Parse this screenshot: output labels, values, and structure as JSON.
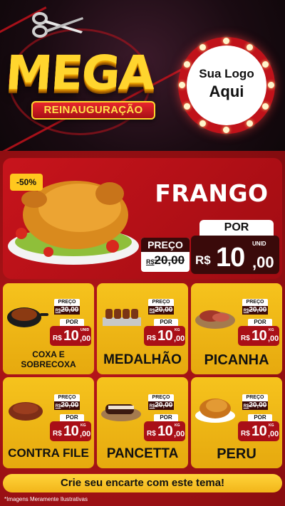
{
  "header": {
    "title": "MEGA",
    "subtitle": "REINAUGURAÇÃO",
    "logo_line1": "Sua Logo",
    "logo_line2": "Aqui"
  },
  "featured": {
    "discount": "-50%",
    "name": "FRANGO",
    "preco_label": "PREÇO",
    "old_currency": "R$",
    "old_price": "20,00",
    "por_label": "POR",
    "currency": "R$",
    "price_int": "10",
    "price_dec": ",00",
    "unit": "UNID"
  },
  "products": [
    {
      "name_line1": "COXA E",
      "name_line2": "SOBRECOXA",
      "preco_label": "PREÇO",
      "old_currency": "R$",
      "old_price": "20,00",
      "por_label": "POR",
      "currency": "R$",
      "price_int": "10",
      "price_dec": ",00",
      "unit": "UNID"
    },
    {
      "name": "MEDALHÃO",
      "preco_label": "PREÇO",
      "old_currency": "R$",
      "old_price": "20,00",
      "por_label": "POR",
      "currency": "R$",
      "price_int": "10",
      "price_dec": ",00",
      "unit": "KG"
    },
    {
      "name": "PICANHA",
      "preco_label": "PREÇO",
      "old_currency": "R$",
      "old_price": "20,00",
      "por_label": "POR",
      "currency": "R$",
      "price_int": "10",
      "price_dec": ",00",
      "unit": "KG"
    },
    {
      "name": "CONTRA FILE",
      "preco_label": "PREÇO",
      "old_currency": "R$",
      "old_price": "20,00",
      "por_label": "POR",
      "currency": "R$",
      "price_int": "10",
      "price_dec": ",00",
      "unit": "KG"
    },
    {
      "name": "PANCETTA",
      "preco_label": "PREÇO",
      "old_currency": "R$",
      "old_price": "20,00",
      "por_label": "POR",
      "currency": "R$",
      "price_int": "10",
      "price_dec": ",00",
      "unit": "KG"
    },
    {
      "name": "PERU",
      "preco_label": "PREÇO",
      "old_currency": "R$",
      "old_price": "20,00",
      "por_label": "POR",
      "currency": "R$",
      "price_int": "10",
      "price_dec": ",00",
      "unit": "KG"
    }
  ],
  "footer": {
    "cta": "Crie seu encarte com este tema!",
    "disclaimer": "*Imagens Meramente Ilustrativas"
  },
  "colors": {
    "background_red": "#a00c12",
    "card_yellow": "#f6c31d",
    "price_dark": "#3a0a0a",
    "price_red": "#a90f17",
    "title_gold": "#ffd52e"
  },
  "icons": [
    "scissors-icon",
    "chicken-image",
    "food-image"
  ]
}
